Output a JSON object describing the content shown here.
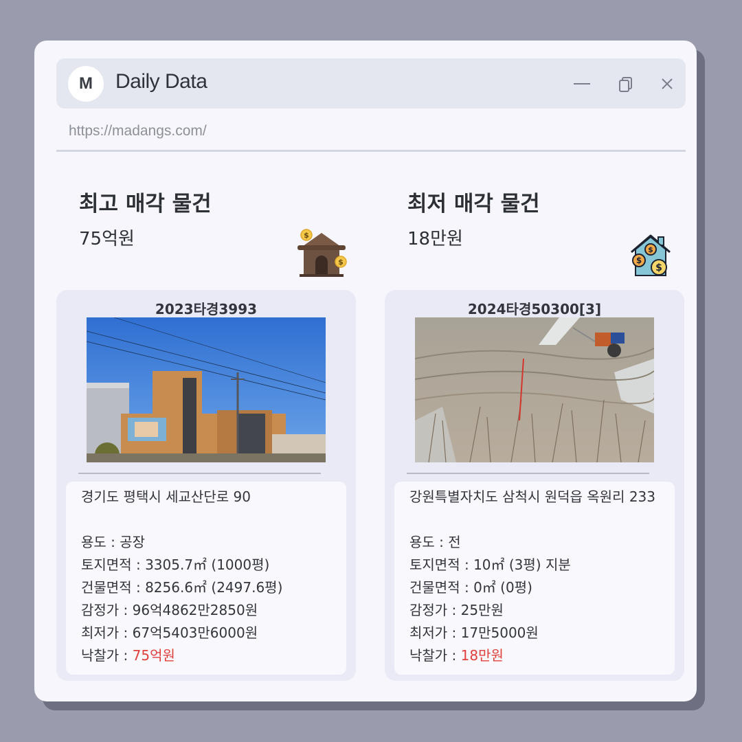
{
  "window": {
    "logo_letter": "M",
    "title": "Daily Data",
    "url": "https://madangs.com/"
  },
  "icons": {
    "minimize": "minimize-icon",
    "restore": "copy-icon",
    "close": "close-icon",
    "highest": "house-coin-icon",
    "lowest": "house-dollar-icon"
  },
  "highest": {
    "heading": "최고 매각 물건",
    "price": "75억원",
    "case_no": "2023타경3993",
    "address": "경기도 평택시 세교산단로 90",
    "usage_label": "용도 : ",
    "usage": "공장",
    "land_label": "토지면적 : ",
    "land": "3305.7㎡ (1000평)",
    "building_label": "건물면적 : ",
    "building": "8256.6㎡ (2497.6평)",
    "appraisal_label": "감정가 : ",
    "appraisal": "96억4862만2850원",
    "minimum_label": "최저가 : ",
    "minimum": "67억5403만6000원",
    "winning_label": "낙찰가 : ",
    "winning": "75억원"
  },
  "lowest": {
    "heading": "최저 매각 물건",
    "price": "18만원",
    "case_no": "2024타경50300[3]",
    "address": "강원특별자치도 삼척시 원덕읍 옥원리 233",
    "usage_label": "용도 : ",
    "usage": "전",
    "land_label": "토지면적 : ",
    "land": "10㎡ (3평) 지분",
    "building_label": "건물면적 : ",
    "building": "0㎡ (0평)",
    "appraisal_label": "감정가 : ",
    "appraisal": "25만원",
    "minimum_label": "최저가 : ",
    "minimum": "17만5000원",
    "winning_label": "낙찰가 : ",
    "winning": "18만원"
  },
  "colors": {
    "background": "#9a9cae",
    "window": "#f6f6fc",
    "titlebar": "#e4e6f0",
    "card": "#e9eaf5",
    "accent_red": "#e0403b"
  }
}
